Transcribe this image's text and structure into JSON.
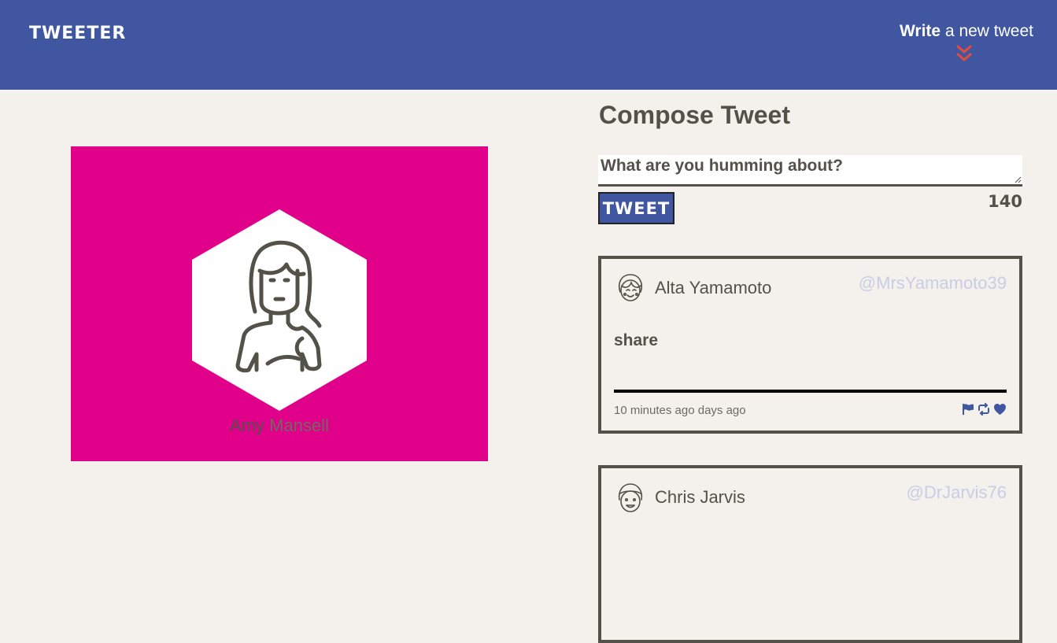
{
  "nav": {
    "brand": "Tweeter",
    "write_bold": "Write",
    "write_rest": " a new tweet",
    "chevron_icon": "double-chevron-down-icon",
    "accent_color": "#e44b3b",
    "background_color": "#4056a1"
  },
  "profile": {
    "background_color": "#e0008a",
    "first_name": "Amy",
    "last_name": " Mansell",
    "avatar_icon": "user-avatar-icon"
  },
  "compose": {
    "title": "Compose Tweet",
    "placeholder": "What are you humming about?",
    "button_label": "Tweet",
    "counter": "140"
  },
  "tweets": [
    {
      "name": "Alta Yamamoto",
      "handle": "@MrsYamamoto39",
      "content": "share",
      "time": "10 minutes ago days ago",
      "avatar_icon": "user-avatar-icon"
    },
    {
      "name": "Chris Jarvis",
      "handle": "@DrJarvis76",
      "avatar_icon": "user-avatar-icon"
    }
  ],
  "tweet_actions": [
    "flag-icon",
    "retweet-icon",
    "heart-icon"
  ],
  "colors": {
    "page_background": "#f4f1ec",
    "text": "#545149",
    "handle": "#c9cde6",
    "action": "#4056a1"
  }
}
